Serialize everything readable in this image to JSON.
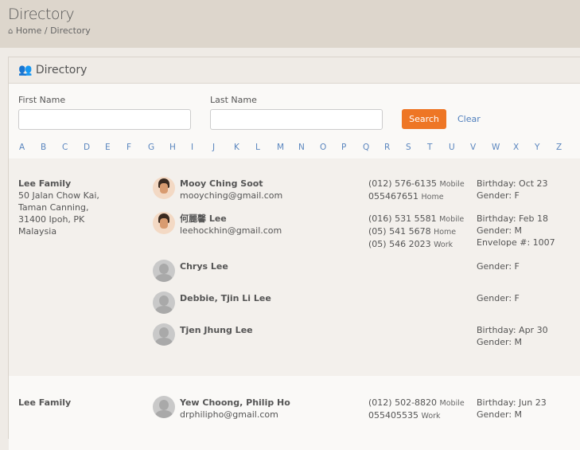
{
  "header": {
    "title": "Directory",
    "breadcrumb": {
      "home": "Home",
      "separator": "/",
      "current": "Directory"
    }
  },
  "panel": {
    "title": "Directory"
  },
  "form": {
    "first_name_label": "First Name",
    "first_name_value": "",
    "last_name_label": "Last Name",
    "last_name_value": "",
    "search_label": "Search",
    "clear_label": "Clear"
  },
  "letters": [
    "A",
    "B",
    "C",
    "D",
    "E",
    "F",
    "G",
    "H",
    "I",
    "J",
    "K",
    "L",
    "M",
    "N",
    "O",
    "P",
    "Q",
    "R",
    "S",
    "T",
    "U",
    "V",
    "W",
    "X",
    "Y",
    "Z"
  ],
  "families": [
    {
      "name": "Lee Family",
      "address": [
        "50 Jalan Chow Kai,",
        "Taman Canning,",
        "31400 Ipoh, PK",
        "Malaysia"
      ],
      "members": [
        {
          "name": "Mooy Ching Soot",
          "email": "mooyching@gmail.com",
          "photo": "photo",
          "phones": [
            {
              "number": "(012) 576-6135",
              "type": "Mobile"
            },
            {
              "number": "055467651",
              "type": "Home"
            }
          ],
          "details": [
            "Birthday: Oct 23",
            "Gender: F"
          ]
        },
        {
          "name": "何麗馨 Lee",
          "email": "leehockhin@gmail.com",
          "photo": "photo",
          "phones": [
            {
              "number": "(016) 531 5581",
              "type": "Mobile"
            },
            {
              "number": "(05) 541 5678",
              "type": "Home"
            },
            {
              "number": "(05) 546 2023",
              "type": "Work"
            }
          ],
          "details": [
            "Birthday: Feb 18",
            "Gender: M",
            "Envelope #: 1007"
          ]
        },
        {
          "name": "Chrys Lee",
          "email": "",
          "photo": "blank",
          "phones": [],
          "details": [
            "Gender: F"
          ]
        },
        {
          "name": "Debbie, Tjin Li Lee",
          "email": "",
          "photo": "blank",
          "phones": [],
          "details": [
            "Gender: F"
          ]
        },
        {
          "name": "Tjen Jhung Lee",
          "email": "",
          "photo": "blank",
          "phones": [],
          "details": [
            "Birthday: Apr 30",
            "Gender: M"
          ]
        }
      ]
    },
    {
      "name": "Lee Family",
      "address": [],
      "members": [
        {
          "name": "Yew Choong, Philip Ho",
          "email": "drphilipho@gmail.com",
          "photo": "blank",
          "phones": [
            {
              "number": "(012) 502-8820",
              "type": "Mobile"
            },
            {
              "number": "055405535",
              "type": "Work"
            }
          ],
          "details": [
            "Birthday: Jun 23",
            "Gender: M"
          ]
        }
      ]
    }
  ]
}
